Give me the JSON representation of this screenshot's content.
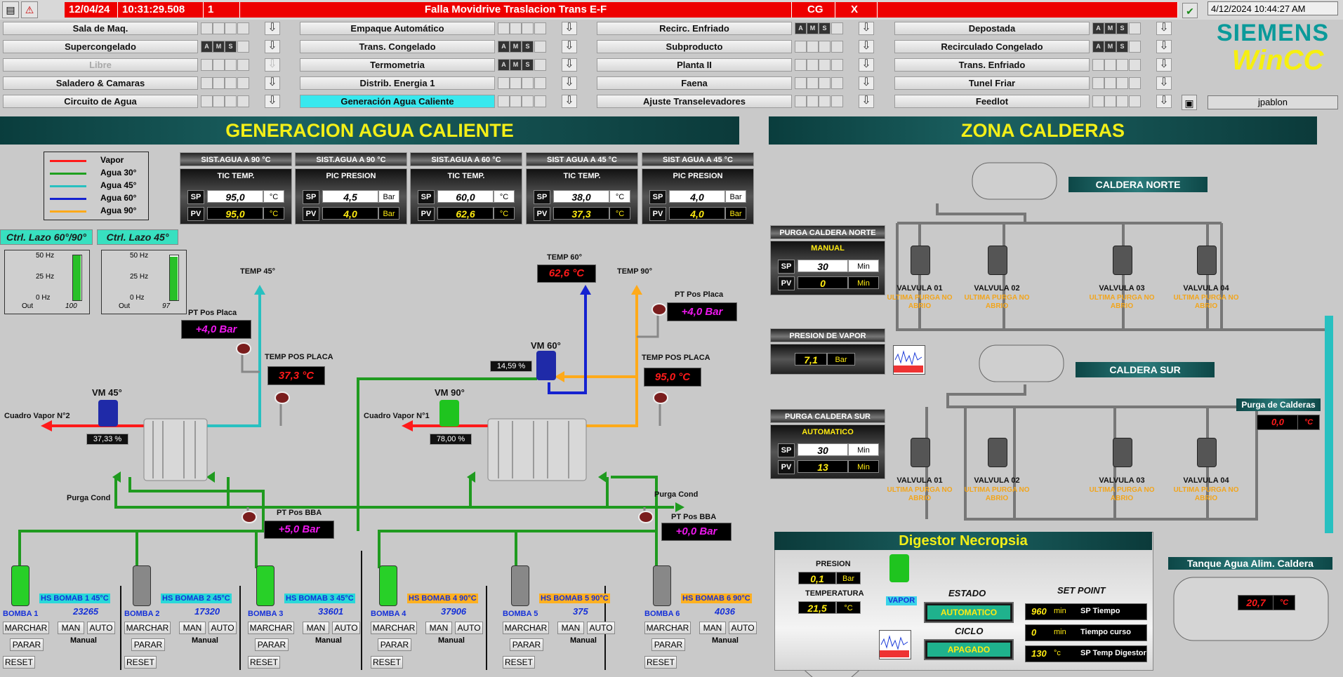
{
  "alarm": {
    "date": "12/04/24",
    "time": "10:31:29.508",
    "count": "1",
    "message": "Falla Movidrive Traslacion Trans E-F",
    "area": "CG",
    "status": "X"
  },
  "clock": "4/12/2024 10:44:27 AM",
  "brand": {
    "name": "SIEMENS",
    "product": "WinCC"
  },
  "user": "jpablon",
  "nav": [
    {
      "label": "Sala de Maq.",
      "ams": false,
      "disabled": false,
      "active": false
    },
    {
      "label": "Supercongelado",
      "ams": true,
      "disabled": false,
      "active": false
    },
    {
      "label": "Libre",
      "ams": false,
      "disabled": true,
      "active": false
    },
    {
      "label": "Saladero & Camaras",
      "ams": false,
      "disabled": false,
      "active": false
    },
    {
      "label": "Circuito de Agua",
      "ams": false,
      "disabled": false,
      "active": false
    },
    {
      "label": "Empaque Automático",
      "ams": false,
      "disabled": false,
      "active": false
    },
    {
      "label": "Trans. Congelado",
      "ams": true,
      "disabled": false,
      "active": false
    },
    {
      "label": "Termometria",
      "ams": true,
      "disabled": false,
      "active": false
    },
    {
      "label": "Distrib. Energia 1",
      "ams": false,
      "disabled": false,
      "active": false
    },
    {
      "label": "Generación Agua Caliente",
      "ams": false,
      "disabled": false,
      "active": true
    },
    {
      "label": "Recirc. Enfriado",
      "ams": true,
      "disabled": false,
      "active": false
    },
    {
      "label": "Subproducto",
      "ams": false,
      "disabled": false,
      "active": false
    },
    {
      "label": "Planta II",
      "ams": false,
      "disabled": false,
      "active": false
    },
    {
      "label": "Faena",
      "ams": false,
      "disabled": false,
      "active": false
    },
    {
      "label": "Ajuste Transelevadores",
      "ams": false,
      "disabled": false,
      "active": false
    },
    {
      "label": "Depostada",
      "ams": true,
      "disabled": false,
      "active": false
    },
    {
      "label": "Recirculado Congelado",
      "ams": true,
      "disabled": false,
      "active": false
    },
    {
      "label": "Trans. Enfriado",
      "ams": false,
      "disabled": false,
      "active": false
    },
    {
      "label": "Tunel Friar",
      "ams": false,
      "disabled": false,
      "active": false
    },
    {
      "label": "Feedlot",
      "ams": false,
      "disabled": false,
      "active": false
    }
  ],
  "ams_labels": [
    "A",
    "M",
    "S"
  ],
  "left_title": "GENERACION AGUA CALIENTE",
  "right_title": "ZONA CALDERAS",
  "legend": [
    {
      "label": "Vapor",
      "color": "#ff1a1a"
    },
    {
      "label": "Agua 30°",
      "color": "#1fa01f"
    },
    {
      "label": "Agua 45°",
      "color": "#28c0c0"
    },
    {
      "label": "Agua 60°",
      "color": "#1522d0"
    },
    {
      "label": "Agua 90°",
      "color": "#ffaa1a"
    }
  ],
  "loops": [
    {
      "head": "SIST.AGUA A 90 °C",
      "tag": "TIC TEMP.",
      "sp": "95,0",
      "pv": "95,0",
      "unit": "°C"
    },
    {
      "head": "SIST.AGUA A 90 °C",
      "tag": "PIC PRESION",
      "sp": "4,5",
      "pv": "4,0",
      "unit": "Bar"
    },
    {
      "head": "SIST.AGUA A 60 °C",
      "tag": "TIC TEMP.",
      "sp": "60,0",
      "pv": "62,6",
      "unit": "°C"
    },
    {
      "head": "SIST AGUA A 45 °C",
      "tag": "TIC TEMP.",
      "sp": "38,0",
      "pv": "37,3",
      "unit": "°C"
    },
    {
      "head": "SIST AGUA A 45 °C",
      "tag": "PIC PRESION",
      "sp": "4,0",
      "pv": "4,0",
      "unit": "Bar"
    }
  ],
  "sp_label": "SP",
  "pv_label": "PV",
  "ctrl": [
    {
      "label": "Ctrl. Lazo 60°/90°",
      "out": "100",
      "level": 1.0
    },
    {
      "label": "Ctrl. Lazo 45°",
      "out": "97",
      "level": 0.97
    }
  ],
  "hz": [
    "50 Hz",
    "25 Hz",
    "0 Hz"
  ],
  "out_label": "Out",
  "left": {
    "temp45": "TEMP 45°",
    "temp60": "TEMP 60°",
    "temp60_val": "62,6 °C",
    "temp90": "TEMP 90°",
    "pt_placa_l": "PT Pos Placa",
    "pt_placa_l_val": "+4,0  Bar",
    "pt_placa_r": "PT Pos Placa",
    "pt_placa_r_val": "+4,0  Bar",
    "temp_placa_l": "TEMP POS PLACA",
    "temp_placa_l_val": "37,3 °C",
    "temp_placa_r": "TEMP POS PLACA",
    "temp_placa_r_val": "95,0 °C",
    "vm45": "VM 45°",
    "vm45_pct": "37,33  %",
    "vm90": "VM 90°",
    "vm90_pct": "78,00  %",
    "vm60": "VM 60°",
    "vm60_pct": "14,59  %",
    "cuadro2": "Cuadro Vapor N°2",
    "cuadro1": "Cuadro Vapor N°1",
    "purga_l": "Purga Cond",
    "purga_r": "Purga Cond",
    "bba_l": "PT Pos BBA",
    "bba_l_val": "+5,0  Bar",
    "bba_r": "PT Pos BBA",
    "bba_r_val": "+0,0  Bar"
  },
  "pumps": [
    {
      "name": "BOMBA 1",
      "hs": "HS BOMAB 1 45°C",
      "count": "23265",
      "running": true,
      "hs_color": "#2ad8d8"
    },
    {
      "name": "BOMBA 2",
      "hs": "HS BOMAB 2 45°C",
      "count": "17320",
      "running": false,
      "hs_color": "#2ad8d8"
    },
    {
      "name": "BOMBA 3",
      "hs": "HS BOMAB 3 45°C",
      "count": "33601",
      "running": true,
      "hs_color": "#2ad8d8"
    },
    {
      "name": "BOMBA 4",
      "hs": "HS BOMAB 4 90°C",
      "count": "37906",
      "running": true,
      "hs_color": "#ffb020"
    },
    {
      "name": "BOMBA 5",
      "hs": "HS BOMAB 5 90°C",
      "count": "375",
      "running": false,
      "hs_color": "#ffb020"
    },
    {
      "name": "BOMBA 6",
      "hs": "HS BOMAB 6 90°C",
      "count": "4036",
      "running": false,
      "hs_color": "#ffb020"
    }
  ],
  "pump_btns": {
    "marchar": "MARCHAR",
    "parar": "PARAR",
    "reset": "RESET",
    "man": "MAN",
    "auto": "AUTO",
    "manual": "Manual"
  },
  "calderas": {
    "norte": "CALDERA NORTE",
    "sur": "CALDERA SUR",
    "purga_norte": {
      "head": "PURGA CALDERA NORTE",
      "mode": "MANUAL",
      "sp": "30",
      "pv": "0",
      "unit": "Min"
    },
    "purga_sur": {
      "head": "PURGA CALDERA SUR",
      "mode": "AUTOMATICO",
      "sp": "30",
      "pv": "13",
      "unit": "Min"
    },
    "presion": {
      "head": "PRESION DE VAPOR",
      "val": "7,1",
      "unit": "Bar"
    },
    "valves_norte": [
      {
        "name": "VALVULA 01",
        "sub": "ULTIMA PURGA NO ABRIO"
      },
      {
        "name": "VALVULA 02",
        "sub": "ULTIMA PURGA NO ABRIO"
      },
      {
        "name": "VALVULA 03",
        "sub": "ULTIMA PURGA NO ABRIO"
      },
      {
        "name": "VALVULA 04",
        "sub": "ULTIMA PURGA NO ABRIO"
      }
    ],
    "valves_sur": [
      {
        "name": "VALVULA 01",
        "sub": "ULTIMA PURGA NO ABRIO"
      },
      {
        "name": "VALVULA 02",
        "sub": "ULTIMA PURGA NO ABRIO"
      },
      {
        "name": "VALVULA 03",
        "sub": "ULTIMA PURGA NO ABRIO"
      },
      {
        "name": "VALVULA 04",
        "sub": "ULTIMA PURGA NO ABRIO"
      }
    ],
    "purga_calderas": "Purga de Calderas",
    "purga_calderas_val": "0,0",
    "purga_calderas_unit": "°C"
  },
  "digestor": {
    "title": "Digestor Necropsia",
    "presion": "PRESION",
    "presion_val": "0,1",
    "presion_unit": "Bar",
    "temp": "TEMPERATURA",
    "temp_val": "21,5",
    "temp_unit": "°C",
    "vapor": "VAPOR",
    "estado": "ESTADO",
    "estado_val": "AUTOMATICO",
    "ciclo": "CICLO",
    "ciclo_val": "APAGADO",
    "setpoint": "SET POINT",
    "sp": [
      {
        "v": "960",
        "u": "min",
        "l": "SP Tiempo"
      },
      {
        "v": "0",
        "u": "min",
        "l": "Tiempo curso"
      },
      {
        "v": "130",
        "u": "°c",
        "l": "SP Temp Digestor"
      }
    ]
  },
  "tanque": {
    "title": "Tanque Agua Alim. Caldera",
    "val": "20,7",
    "unit": "°C"
  }
}
